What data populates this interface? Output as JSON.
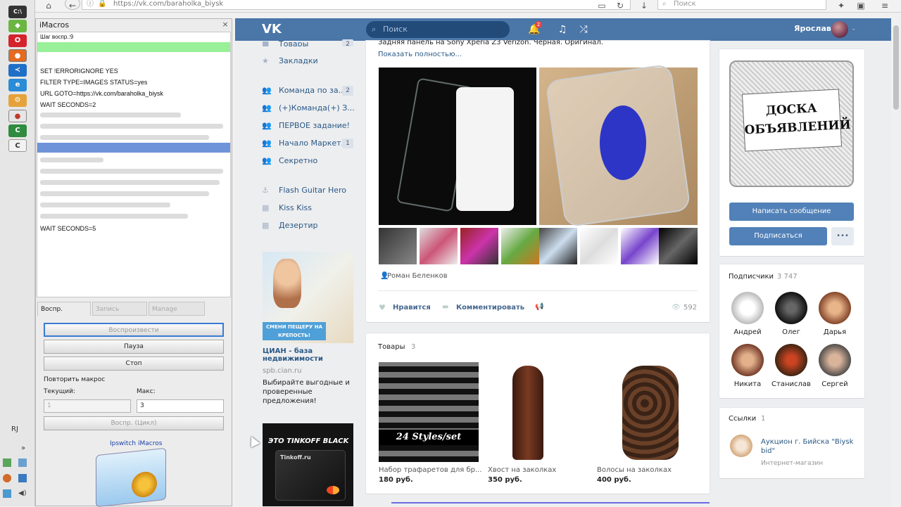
{
  "browser": {
    "url": "https://vk.com/baraholka_biysk",
    "search_placeholder": "Поиск"
  },
  "taskbar": {
    "icons": [
      "cmd-icon",
      "android-icon",
      "opera-icon",
      "firefox-icon",
      "vscode-icon",
      "ie-icon",
      "chrome-icon",
      "camtasia-icon",
      "ccleaner-icon"
    ],
    "lang": "RJ",
    "expand": "»"
  },
  "imacros": {
    "title": "iMacros",
    "status_line": "Шаг воспр.:9",
    "lines": [
      "SET !ERRORIGNORE YES",
      "FILTER TYPE=IMAGES STATUS=yes",
      "URL GOTO=https://vk.com/baraholka_biysk",
      "WAIT SECONDS=2",
      "WAIT SECONDS=5"
    ],
    "tabs": [
      "Воспр.",
      "Запись",
      "Manage"
    ],
    "play_button": "Воспроизвести",
    "pause_button": "Пауза",
    "stop_button": "Стоп",
    "repeat_label": "Повторить макрос",
    "current_label": "Текущий:",
    "max_label": "Макс:",
    "current_value": "1",
    "max_value": "3",
    "loop_button": "Воспр. (Цикл)",
    "brand": "Ipswitch iMacros"
  },
  "vk": {
    "search_placeholder": "Поиск",
    "notification_count": "2",
    "user_name": "Ярослав",
    "menu": [
      {
        "label": "Товары",
        "count": "2",
        "icon": "shopping-icon"
      },
      {
        "label": "Закладки",
        "count": "",
        "icon": "star-icon"
      },
      {
        "label": "Команда по за...",
        "count": "2",
        "icon": "group-icon"
      },
      {
        "label": "(+)Команда(+) З...",
        "count": "",
        "icon": "group-icon"
      },
      {
        "label": "ПЕРВОЕ задание!",
        "count": "",
        "icon": "group-icon"
      },
      {
        "label": "Начало Маркет...",
        "count": "1",
        "icon": "group-icon"
      },
      {
        "label": "Секретно",
        "count": "",
        "icon": "group-icon"
      },
      {
        "label": "Flash Guitar Hero",
        "count": "",
        "icon": "game-icon"
      },
      {
        "label": "Kiss Kiss",
        "count": "",
        "icon": "app-icon"
      },
      {
        "label": "Дезертир",
        "count": "",
        "icon": "app-icon"
      }
    ],
    "ad1": {
      "banner_text": "СМЕНИ ПЕЩЕРУ НА КРЕПОСТЬ!",
      "title": "ЦИАН - база недвижимости",
      "domain": "spb.cian.ru",
      "description": "Выбирайте выгодные и проверенные предложения!"
    },
    "ad2": {
      "banner_title": "ЭТО TINKOFF BLACK",
      "card_brand": "Tinkoff.ru"
    },
    "post": {
      "text_line": "Задняя панель на Sony Xperia Z3 Verizon. Черная. Оригинал.",
      "show_more": "Показать полностью...",
      "author": "Роман Беленков",
      "like_label": "Нравится",
      "comment_label": "Комментировать",
      "views": "592"
    },
    "goods": {
      "title": "Товары",
      "count": "3",
      "items": [
        {
          "name": "Набор трафаретов для бр...",
          "price": "180 руб.",
          "image_text": "24 Styles/set"
        },
        {
          "name": "Хвост на заколках",
          "price": "350 руб."
        },
        {
          "name": "Волосы на заколках",
          "price": "400 руб."
        }
      ]
    },
    "community": {
      "cover_text": "ДОСКА ОБЪЯВЛЕНИЙ",
      "message_button": "Написать сообщение",
      "subscribe_button": "Подписаться",
      "more_button": "•••"
    },
    "subscribers": {
      "title": "Подписчики",
      "count": "3 747",
      "people": [
        "Андрей",
        "Олег",
        "Дарья",
        "Никита",
        "Станислав",
        "Сергей"
      ]
    },
    "links": {
      "title": "Ссылки",
      "count": "1",
      "item_title": "Аукцион г. Бийска \"Biysk bid\"",
      "item_subtitle": "Интернет-магазин"
    }
  }
}
